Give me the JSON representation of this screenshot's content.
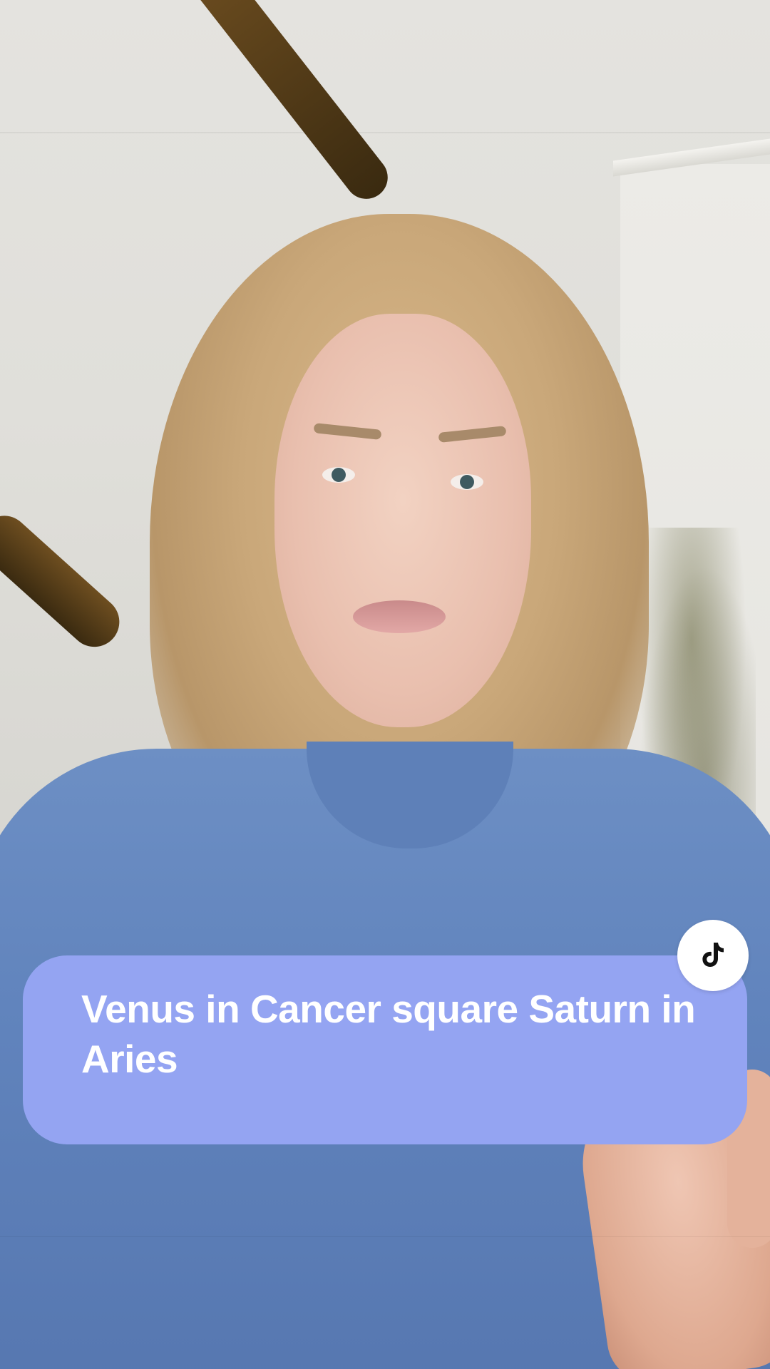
{
  "caption": {
    "text": "Venus in Cancer square Saturn in Aries",
    "background_color": "#94a4f2",
    "text_color": "#ffffff"
  },
  "badge": {
    "icon": "tiktok-logo-icon",
    "background_color": "#ffffff",
    "icon_color": "#111111"
  },
  "video": {
    "description_icon": "video-frame"
  }
}
